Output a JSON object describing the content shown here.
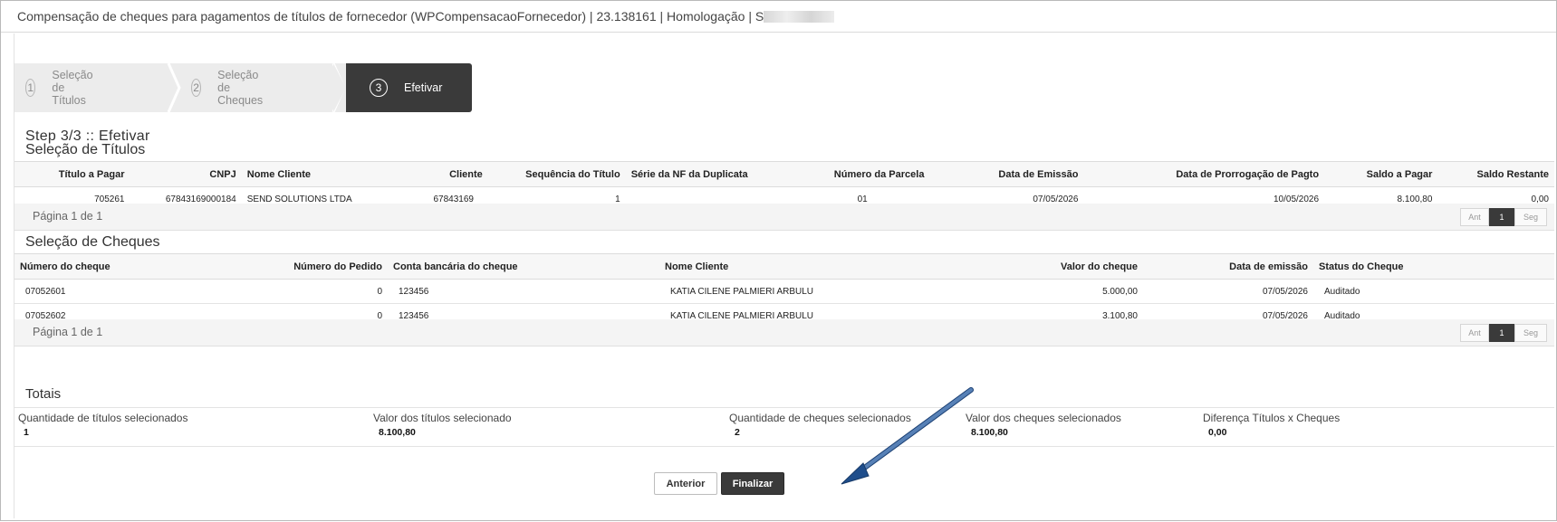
{
  "window": {
    "title": "Compensação de cheques para pagamentos de títulos de fornecedor (WPCompensacaoFornecedor) | 23.138161 | Homologação | S"
  },
  "wizard": {
    "steps": [
      {
        "num": "1",
        "label": "Seleção de Títulos"
      },
      {
        "num": "2",
        "label": "Seleção de Cheques"
      },
      {
        "num": "3",
        "label": "Efetivar"
      }
    ],
    "active": 3
  },
  "main": {
    "step_heading": "Step 3/3 :: Efetivar",
    "titulos": {
      "heading": "Seleção de Títulos",
      "columns": [
        "Título a Pagar",
        "CNPJ",
        "Nome Cliente",
        "Cliente",
        "Sequência do Título",
        "Série da NF da Duplicata",
        "Número da Parcela",
        "Data de Emissão",
        "Data de Prorrogação de Pagto",
        "Saldo a Pagar",
        "Saldo Restante"
      ],
      "rows": [
        [
          "705261",
          "67843169000184",
          "SEND SOLUTIONS LTDA",
          "67843169",
          "1",
          "",
          "01",
          "07/05/2026",
          "10/05/2026",
          "8.100,80",
          "0,00"
        ]
      ],
      "pager": {
        "info": "Página 1 de 1",
        "prev": "Ant",
        "current": "1",
        "next": "Seg"
      }
    },
    "cheques": {
      "heading": "Seleção de Cheques",
      "columns": [
        "Número do cheque",
        "Número do Pedido",
        "Conta bancária do cheque",
        "Nome Cliente",
        "Valor do cheque",
        "Data de emissão",
        "Status do Cheque"
      ],
      "rows": [
        [
          "07052601",
          "0",
          "123456",
          "KATIA CILENE PALMIERI ARBULU",
          "5.000,00",
          "07/05/2026",
          "Auditado"
        ],
        [
          "07052602",
          "0",
          "123456",
          "KATIA CILENE PALMIERI ARBULU",
          "3.100,80",
          "07/05/2026",
          "Auditado"
        ]
      ],
      "pager": {
        "info": "Página 1 de 1",
        "prev": "Ant",
        "current": "1",
        "next": "Seg"
      }
    },
    "totais": {
      "heading": "Totais",
      "items": [
        {
          "label": "Quantidade de títulos selecionados",
          "value": "1"
        },
        {
          "label": "Valor dos títulos selecionado",
          "value": "8.100,80"
        },
        {
          "label": "Quantidade de cheques selecionados",
          "value": "2"
        },
        {
          "label": "Valor dos cheques selecionados",
          "value": "8.100,80"
        },
        {
          "label": "Diferença Títulos x Cheques",
          "value": "0,00"
        }
      ]
    },
    "buttons": {
      "previous": "Anterior",
      "finish": "Finalizar"
    }
  },
  "colors": {
    "active_step": "#3a3a3a",
    "arrow": "#1f4e8c"
  }
}
